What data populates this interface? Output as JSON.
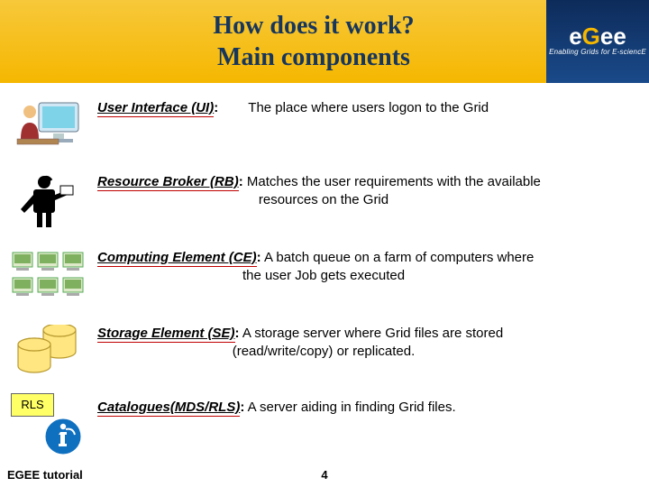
{
  "header": {
    "title_line1": "How does it work?",
    "title_line2": "Main components"
  },
  "logo": {
    "text": "eGee",
    "tagline": "Enabling Grids for E-sciencE"
  },
  "rows": {
    "ui": {
      "term": "User Interface (UI)",
      "colon": ":",
      "desc": "The place where users logon to the Grid"
    },
    "rb": {
      "term": "Resource Broker (RB)",
      "colon": ":",
      "desc2a": " Matches the user requirements with the available",
      "desc2b": "resources on the Grid"
    },
    "ce": {
      "term": "Computing Element (CE)",
      "colon": ":",
      "desc2a": " A batch queue on a farm of computers where",
      "desc2b": "the user Job gets executed"
    },
    "se": {
      "term": "Storage Element (SE)",
      "colon": ":",
      "desc2a": " A storage server where Grid files are stored",
      "desc2b": "(read/write/copy) or replicated."
    },
    "cat": {
      "term": "Catalogues(MDS/RLS)",
      "colon": ":",
      "desc": " A server aiding in finding Grid files."
    }
  },
  "rls_label": "RLS",
  "footer": {
    "left": "EGEE tutorial",
    "page": "4"
  }
}
